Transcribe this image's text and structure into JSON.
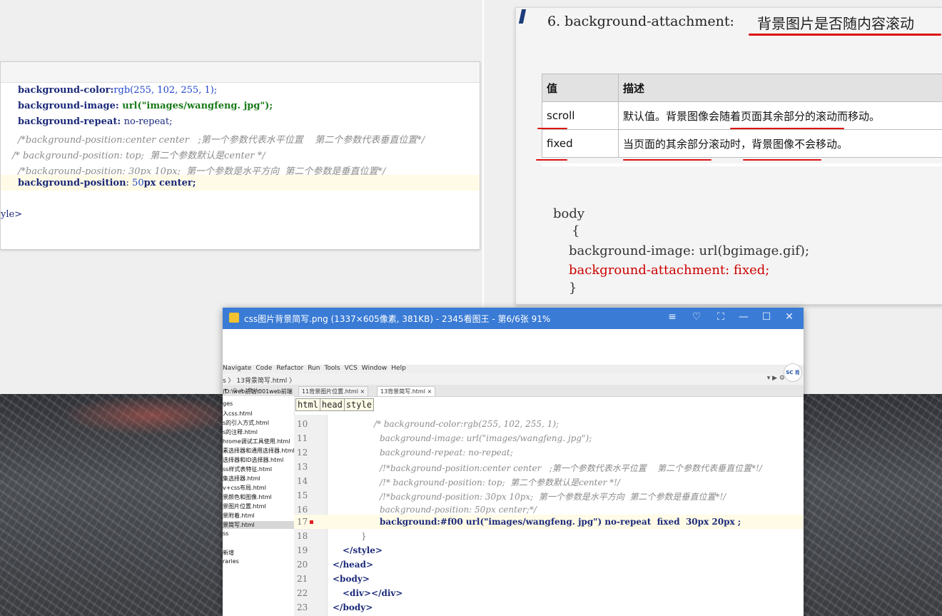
{
  "panel1": {
    "lines": [
      {
        "prop": "background-color",
        "sep": ":",
        "val": "rgb(255, 102, 255, 1);"
      },
      {
        "prop": "background-image",
        "sep": ": ",
        "val": "url(\"images/wangfeng. jpg\");"
      },
      {
        "prop": "background-repeat",
        "sep": ": ",
        "val": "no-repeat;"
      }
    ],
    "comment1": "/*background-position:center center   ;第一个参数代表水平位置    第二个参数代表垂直位置*/",
    "comment2": "/* background-position: top;  第二个参数默认是center */",
    "comment3": "/*background-position: 30px 10px;  第一个参数是水平方向  第二个参数是垂直位置*/",
    "active_prop": "background-position",
    "active_val_num": "50",
    "active_val_rest": "px center;",
    "edge_text": "yle>"
  },
  "slide": {
    "title": "6. background-attachment:",
    "title_cn": "背景图片是否随内容滚动",
    "table_headers": [
      "值",
      "描述"
    ],
    "rows": [
      [
        "scroll",
        "默认值。背景图像会随着页面其余部分的滚动而移动。"
      ],
      [
        "fixed",
        "当页面的其余部分滚动时，背景图像不会移动。"
      ]
    ],
    "code": [
      "body",
      "{",
      "background-image: url(bgimage.gif);",
      "background-attachment: fixed;",
      "}"
    ]
  },
  "viewer": {
    "title": "css图片背景简写.png  (1337×605像素, 381KB)  - 2345看图王 - 第6/6张 91%",
    "controls": [
      "≡",
      "♡",
      "⛶",
      "—",
      "☐",
      "✕"
    ]
  },
  "ide": {
    "menu": [
      "Navigate",
      "Code",
      "Refactor",
      "Run",
      "Tools",
      "VCS",
      "Window",
      "Help"
    ],
    "breadcrumb": "s 〉 13背景简写.html 〉",
    "project_root": "(D:\\web前端\\001web前端",
    "tabs": [
      "11背景图片位置.html ×",
      "13背景简写.html ×"
    ],
    "crumbs": [
      "html",
      "head",
      "style"
    ],
    "badge": "SC 肖宇",
    "project_items": [
      "ges",
      "入css.html",
      "s的引入方式.html",
      "s的注释.html",
      "hrome调试工具使用.html",
      "素选择器和通用选择器.html",
      "选择器和ID选择器.html",
      "ss样式表特征.html",
      "集选择器.html",
      "v+css布局.html",
      "景颜色和图像.html",
      "景图片位置.html",
      "景附着.html",
      "景简写.html",
      "ss",
      "",
      "新增",
      "raries"
    ],
    "line_numbers": [
      "10",
      "11",
      "12",
      "13",
      "14",
      "15",
      "16",
      "17",
      "18",
      "19",
      "20",
      "21",
      "22",
      "23"
    ],
    "code": [
      "/* background-color:rgb(255, 102, 255, 1);",
      "background-image: url(\"images/wangfeng. jpg\");",
      "background-repeat: no-repeat;",
      "/!*background-position:center center   ;第一个参数代表水平位置    第二个参数代表垂直位置*!/",
      "/!* background-position: top;  第二个参数默认是center *!/",
      "/!*background-position: 30px 10px;  第一个参数是水平方向  第二个参数是垂直位置*!/",
      "background-position: 50px center;*/",
      "background:#f00 url(\"images/wangfeng. jpg\") no-repeat  fixed  30px 20px ;",
      "}",
      "</style>",
      "</head>",
      "<body>",
      "<div></div>",
      "</body>"
    ]
  }
}
